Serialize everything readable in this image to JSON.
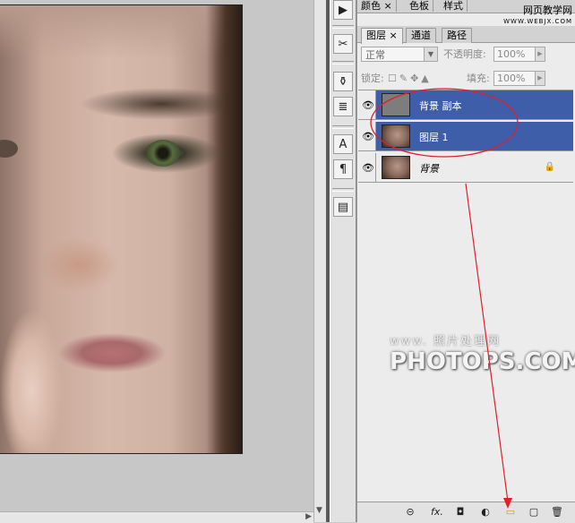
{
  "top_tabs": [
    {
      "label": "颜色",
      "close": "×"
    },
    {
      "label": "色板"
    },
    {
      "label": "样式"
    }
  ],
  "watermark_top": {
    "line1": "网页教学网",
    "line2": "WWW.WEBJX.COM"
  },
  "layers_panel": {
    "tabs": [
      {
        "label": "图层",
        "close": "×"
      },
      {
        "label": "通道"
      },
      {
        "label": "路径"
      }
    ],
    "blend_mode": "正常",
    "opacity_label": "不透明度:",
    "opacity_value": "100%",
    "lock_label": "锁定:",
    "fill_label": "填充:",
    "fill_value": "100%",
    "layers": [
      {
        "name": "背景 副本",
        "selected": true,
        "thumb": "gray"
      },
      {
        "name": "图层 1",
        "selected": true,
        "thumb": "face"
      },
      {
        "name": "背景",
        "selected": false,
        "thumb": "face",
        "locked": true
      }
    ]
  },
  "canvas_watermark": {
    "line1": "www.  照片处理网",
    "line2": "PHOTOPS.COM"
  },
  "icons": {
    "eye": "eye-icon",
    "lock": "lock-icon",
    "link": "link-layers-icon",
    "fx": "fx-icon",
    "mask": "layer-mask-icon",
    "adjustment": "adjustment-layer-icon",
    "group": "new-group-icon",
    "new_layer": "new-layer-icon",
    "trash": "trash-icon"
  },
  "bottom_bar": {
    "fx_label": "fx."
  },
  "annotation_color": "#e0202a"
}
